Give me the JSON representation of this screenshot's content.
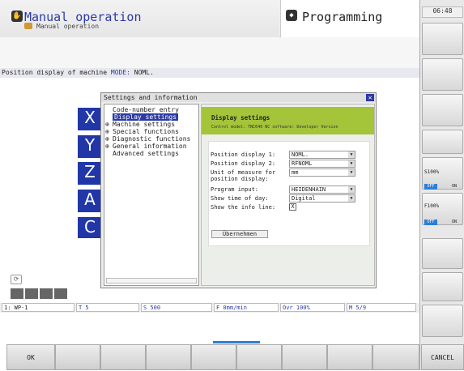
{
  "header": {
    "mode_title": "Manual operation",
    "mode_subtitle": "Manual operation",
    "program_title": "Programming",
    "clock": "06:48"
  },
  "position_row": {
    "label": "Position display of machine",
    "mode_label": "MODE:",
    "mode_value": "NOML."
  },
  "axes": [
    "X",
    "Y",
    "Z",
    "A",
    "C"
  ],
  "dialog": {
    "title": "Settings and information",
    "close": "✕",
    "tree": [
      "Code-number entry",
      "Display settings",
      "Machine settings",
      "Special functions",
      "Diagnostic functions",
      "General information",
      "Advanced settings"
    ],
    "tree_expand": "⊕",
    "panel_title": "Display settings",
    "panel_subtitle": "Control model: TNC640 NC software: Developer Version",
    "fields": [
      {
        "label": "Position display 1:",
        "value": "NOML."
      },
      {
        "label": "Position display 2:",
        "value": "RFNOML"
      },
      {
        "label": "Unit of measure for position display:",
        "value": "mm"
      },
      {
        "label": "Program input:",
        "value": "HEIDENHAIN"
      },
      {
        "label": "Show time of day:",
        "value": "Digital"
      },
      {
        "label": "Show the info line:",
        "value": "X"
      }
    ],
    "apply": "Übernehmen"
  },
  "status": {
    "wp": "1: WP-1",
    "tool": "T 5",
    "spindle": "S 500",
    "feed": "F 0mm/min",
    "ovr": "Ovr 100%",
    "m": "M 5/9"
  },
  "right": {
    "s_override": "S100%",
    "s_off": "OFF",
    "s_on": "ON",
    "f_override": "F100%",
    "f_off": "OFF",
    "f_on": "ON"
  },
  "softkeys": {
    "ok": "OK",
    "cancel": "CANCEL"
  }
}
